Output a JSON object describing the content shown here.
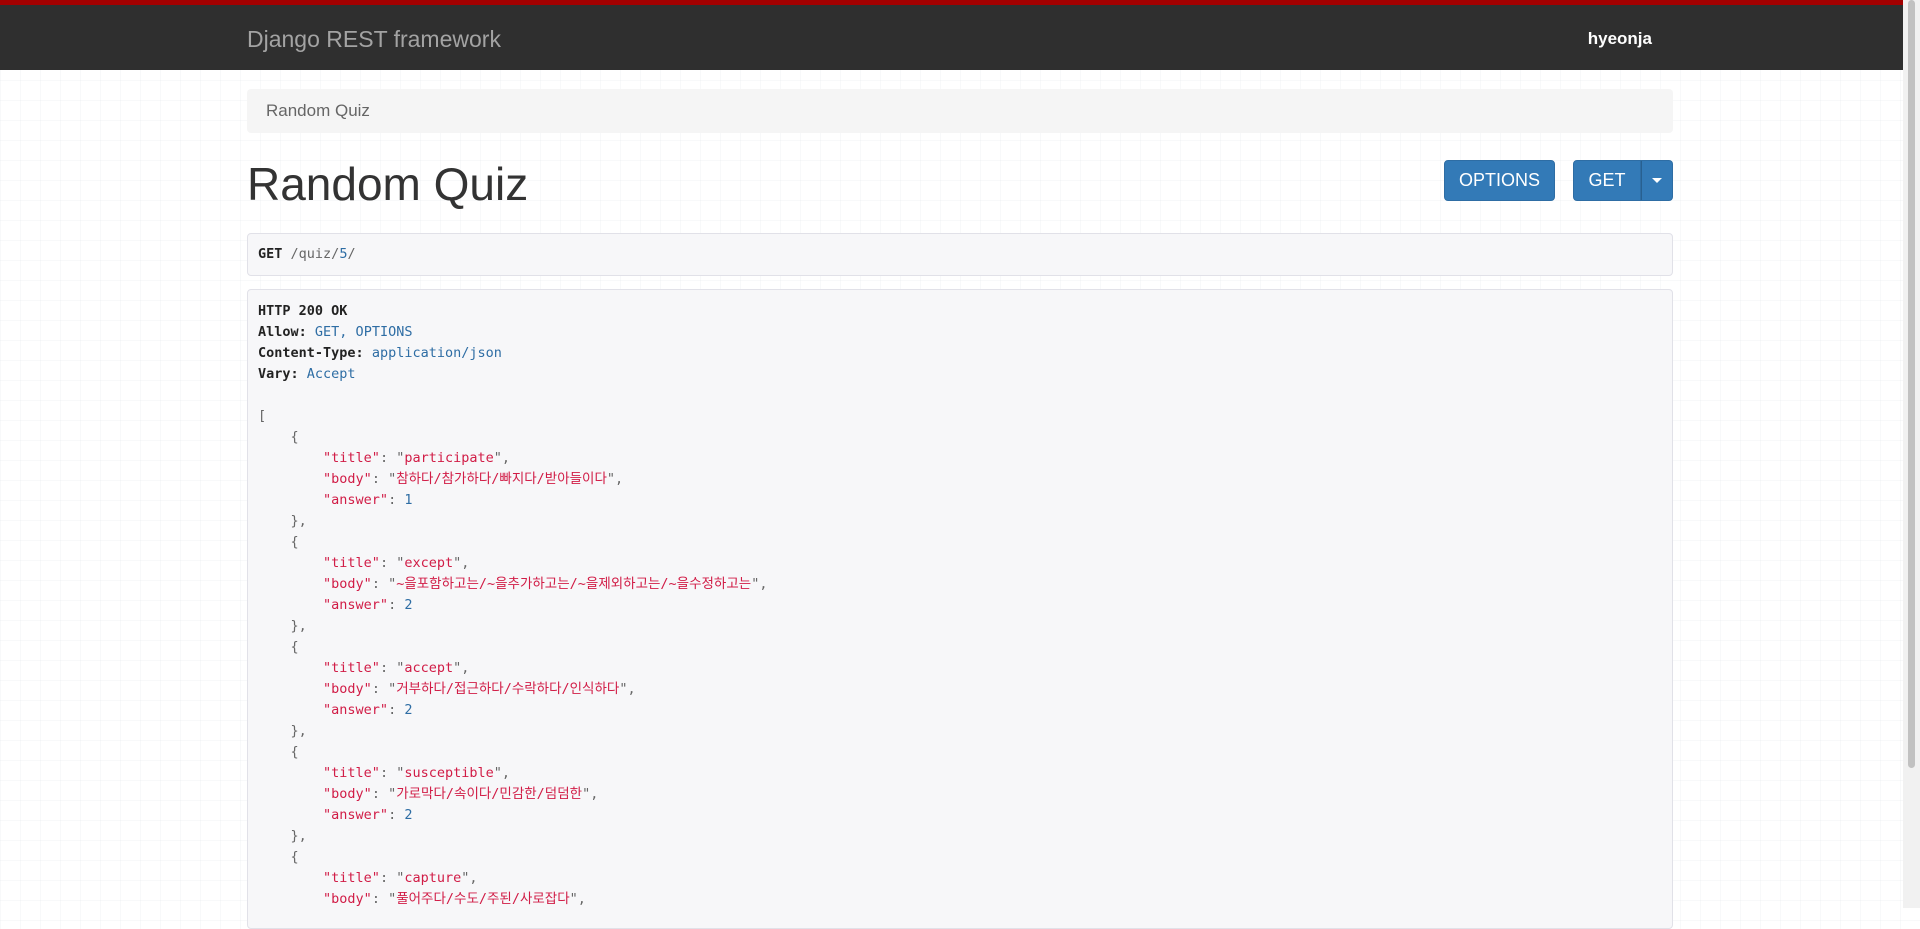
{
  "navbar": {
    "brand": "Django REST framework",
    "user": "hyeonja"
  },
  "breadcrumb": {
    "current": "Random Quiz"
  },
  "page": {
    "title": "Random Quiz"
  },
  "buttons": {
    "options": "OPTIONS",
    "get": "GET"
  },
  "request": {
    "method": "GET",
    "path_prefix": "/quiz/",
    "path_id": "5",
    "path_suffix": "/"
  },
  "response": {
    "status": "HTTP 200 OK",
    "headers": [
      {
        "name": "Allow:",
        "value": "GET, OPTIONS"
      },
      {
        "name": "Content-Type:",
        "value": "application/json"
      },
      {
        "name": "Vary:",
        "value": "Accept"
      }
    ],
    "items": [
      {
        "title": "participate",
        "body": "참하다/참가하다/빠지다/받아들이다",
        "answer": "1"
      },
      {
        "title": "except",
        "body": "~을포함하고는/~을추가하고는/~을제외하고는/~을수정하고는",
        "answer": "2"
      },
      {
        "title": "accept",
        "body": "거부하다/접근하다/수락하다/인식하다",
        "answer": "2"
      },
      {
        "title": "susceptible",
        "body": "가로막다/속이다/민감한/덤덤한",
        "answer": "2"
      },
      {
        "title": "capture",
        "body": "풀어주다/수도/주된/사로잡다",
        "answer": ""
      }
    ]
  },
  "icons": {
    "get_dropdown": "caret-down-icon"
  }
}
